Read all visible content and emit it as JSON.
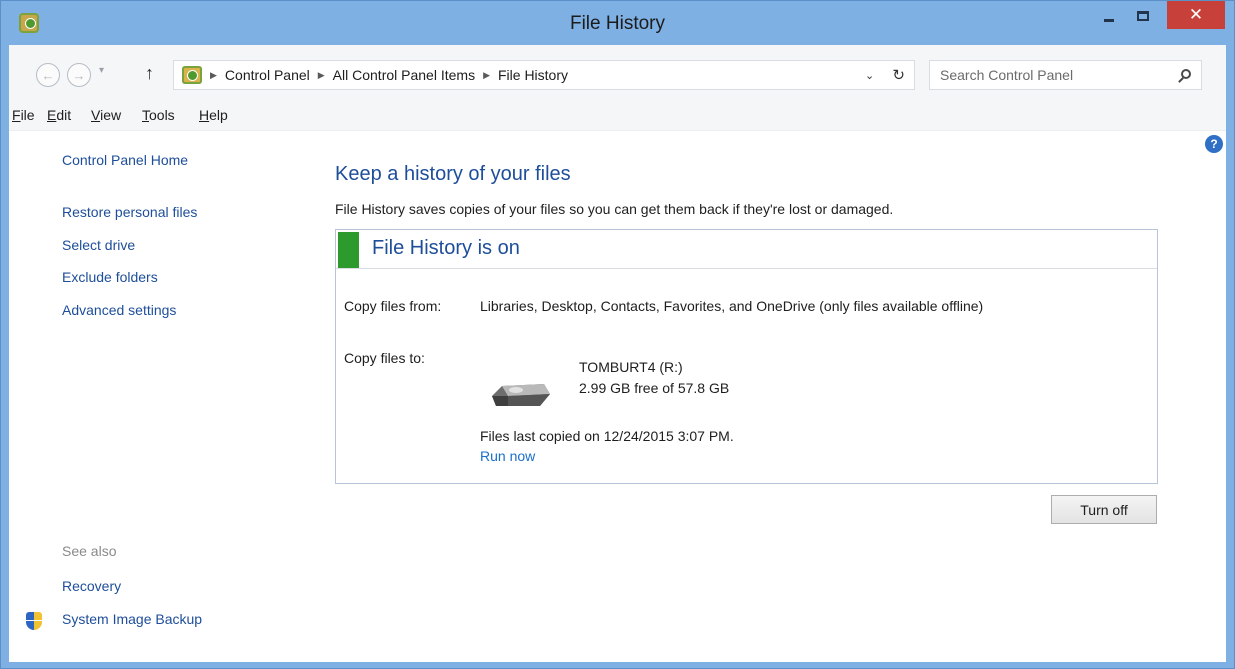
{
  "window": {
    "title": "File History"
  },
  "nav": {
    "back_icon": "arrow-left-icon",
    "forward_icon": "arrow-right-icon",
    "up_icon": "arrow-up-icon",
    "breadcrumbs": [
      "Control Panel",
      "All Control Panel Items",
      "File History"
    ],
    "search_placeholder": "Search Control Panel"
  },
  "menu": {
    "items": [
      {
        "mnemonic": "F",
        "rest": "ile"
      },
      {
        "mnemonic": "E",
        "rest": "dit"
      },
      {
        "mnemonic": "V",
        "rest": "iew"
      },
      {
        "mnemonic": "T",
        "rest": "ools"
      },
      {
        "mnemonic": "H",
        "rest": "elp"
      }
    ]
  },
  "sidebar": {
    "home": "Control Panel Home",
    "links": [
      "Restore personal files",
      "Select drive",
      "Exclude folders",
      "Advanced settings"
    ],
    "see_also_label": "See also",
    "see_also": [
      "Recovery",
      "System Image Backup"
    ]
  },
  "main": {
    "heading": "Keep a history of your files",
    "description": "File History saves copies of your files so you can get them back if they're lost or damaged.",
    "status_title": "File History is on",
    "status_color": "#2d9a2d",
    "copy_from_label": "Copy files from:",
    "copy_from_value": "Libraries, Desktop, Contacts, Favorites, and OneDrive (only files available offline)",
    "copy_to_label": "Copy files to:",
    "drive_name": "TOMBURT4 (R:)",
    "drive_space": "2.99 GB free of 57.8 GB",
    "last_copied": "Files last copied on 12/24/2015 3:07 PM.",
    "run_now": "Run now",
    "turn_off": "Turn off"
  }
}
